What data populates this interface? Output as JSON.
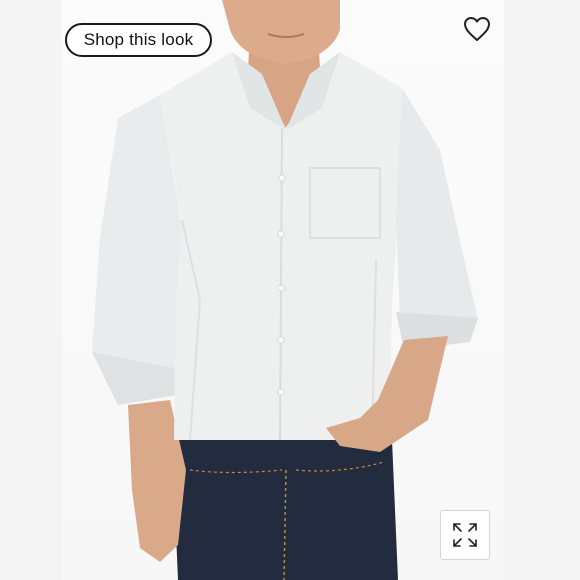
{
  "overlay": {
    "shop_button_label": "Shop this look"
  },
  "icons": {
    "favorite": "heart-outline-icon",
    "expand": "expand-arrows-icon"
  },
  "colors": {
    "shirt": "#eef0f0",
    "jeans": "#242c3f",
    "skin": "#d9a98a",
    "button_border": "#1a1a1a"
  }
}
